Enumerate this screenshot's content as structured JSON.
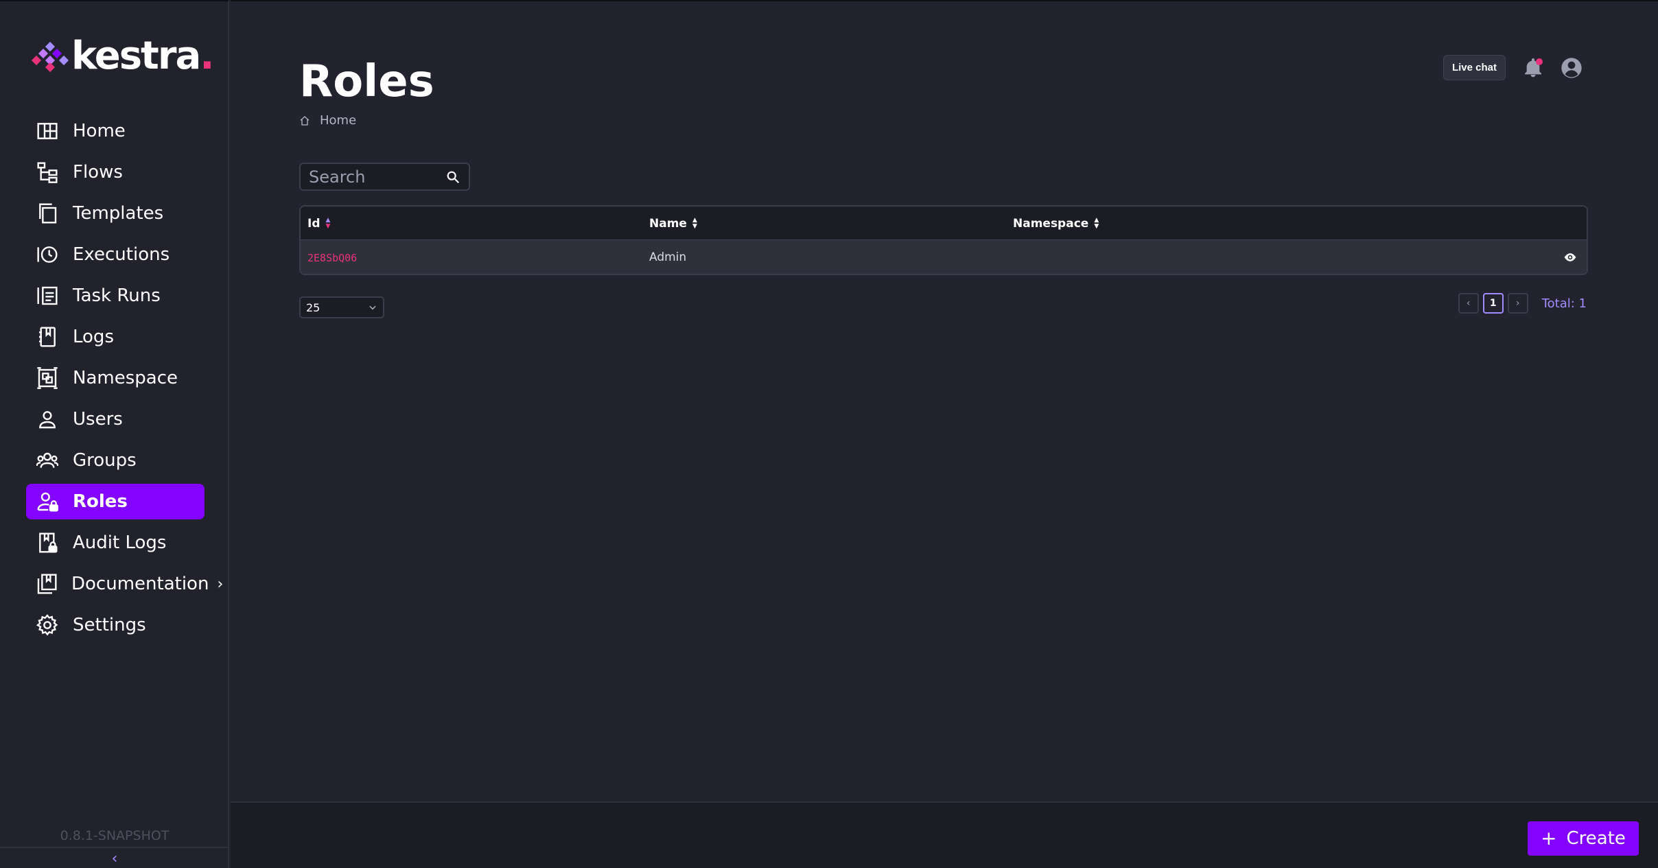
{
  "brand": {
    "name": "kestra",
    "dot": ".",
    "accent": "#8405ff",
    "pink": "#e8327c"
  },
  "sidebar": {
    "items": [
      {
        "label": "Home",
        "icon": "home-icon"
      },
      {
        "label": "Flows",
        "icon": "flows-icon"
      },
      {
        "label": "Templates",
        "icon": "templates-icon"
      },
      {
        "label": "Executions",
        "icon": "executions-icon"
      },
      {
        "label": "Task Runs",
        "icon": "task-runs-icon"
      },
      {
        "label": "Logs",
        "icon": "logs-icon"
      },
      {
        "label": "Namespace",
        "icon": "namespace-icon"
      },
      {
        "label": "Users",
        "icon": "user-icon"
      },
      {
        "label": "Groups",
        "icon": "groups-icon"
      },
      {
        "label": "Roles",
        "icon": "roles-icon",
        "active": true
      },
      {
        "label": "Audit Logs",
        "icon": "audit-logs-icon"
      },
      {
        "label": "Documentation",
        "icon": "documentation-icon",
        "has_submenu": true
      },
      {
        "label": "Settings",
        "icon": "gear-icon"
      }
    ],
    "version": "0.8.1-SNAPSHOT",
    "collapse_symbol": "‹"
  },
  "header": {
    "title": "Roles",
    "breadcrumb": "Home",
    "live_chat": "Live chat"
  },
  "search": {
    "placeholder": "Search"
  },
  "table": {
    "columns": [
      {
        "label": "Id",
        "sorted": true
      },
      {
        "label": "Name"
      },
      {
        "label": "Namespace"
      }
    ],
    "rows": [
      {
        "id": "2E8SbQ06",
        "name": "Admin",
        "namespace": ""
      }
    ]
  },
  "pagination": {
    "page_size": "25",
    "prev": "‹",
    "current_page": "1",
    "next": "›",
    "total": "Total: 1"
  },
  "actions": {
    "create_label": "Create",
    "create_symbol": "+"
  }
}
